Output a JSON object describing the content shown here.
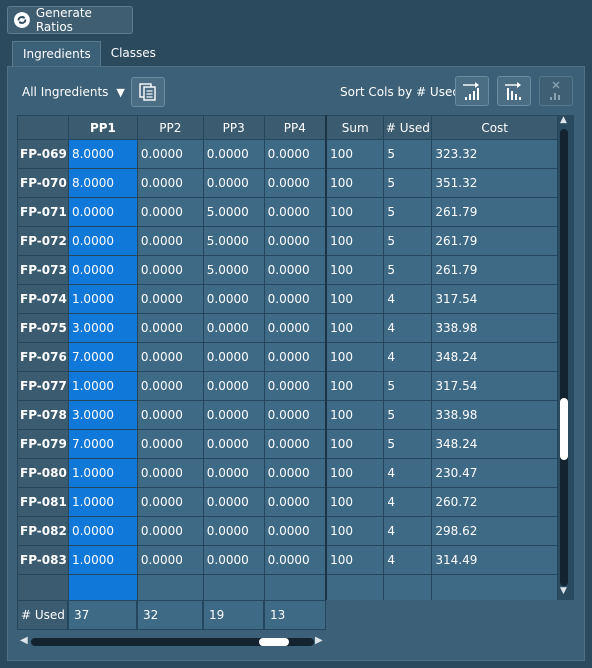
{
  "toolbar": {
    "generate_label": "Generate Ratios",
    "generate_icon": "refresh-icon"
  },
  "tabs": [
    {
      "label": "Ingredients",
      "active": true
    },
    {
      "label": "Classes",
      "active": false
    }
  ],
  "filter": {
    "selected": "All Ingredients",
    "copy_icon": "copy-icon"
  },
  "sort": {
    "label": "Sort Cols by # Used:",
    "buttons": [
      {
        "icon": "sort-ascending-icon",
        "enabled": true
      },
      {
        "icon": "sort-descending-icon",
        "enabled": true
      },
      {
        "icon": "clear-sort-icon",
        "enabled": false
      }
    ]
  },
  "grid": {
    "columns": [
      "PP1",
      "PP2",
      "PP3",
      "PP4",
      "Sum",
      "# Used",
      "Cost"
    ],
    "selected_column": "PP1",
    "rows": [
      {
        "id": "FP-069",
        "values": [
          "8.0000",
          "0.0000",
          "0.0000",
          "0.0000",
          "100",
          "5",
          "323.32"
        ]
      },
      {
        "id": "FP-070",
        "values": [
          "8.0000",
          "0.0000",
          "0.0000",
          "0.0000",
          "100",
          "5",
          "351.32"
        ]
      },
      {
        "id": "FP-071",
        "values": [
          "0.0000",
          "0.0000",
          "5.0000",
          "0.0000",
          "100",
          "5",
          "261.79"
        ]
      },
      {
        "id": "FP-072",
        "values": [
          "0.0000",
          "0.0000",
          "5.0000",
          "0.0000",
          "100",
          "5",
          "261.79"
        ]
      },
      {
        "id": "FP-073",
        "values": [
          "0.0000",
          "0.0000",
          "5.0000",
          "0.0000",
          "100",
          "5",
          "261.79"
        ]
      },
      {
        "id": "FP-074",
        "values": [
          "1.0000",
          "0.0000",
          "0.0000",
          "0.0000",
          "100",
          "4",
          "317.54"
        ]
      },
      {
        "id": "FP-075",
        "values": [
          "3.0000",
          "0.0000",
          "0.0000",
          "0.0000",
          "100",
          "4",
          "338.98"
        ]
      },
      {
        "id": "FP-076",
        "values": [
          "7.0000",
          "0.0000",
          "0.0000",
          "0.0000",
          "100",
          "4",
          "348.24"
        ]
      },
      {
        "id": "FP-077",
        "values": [
          "1.0000",
          "0.0000",
          "0.0000",
          "0.0000",
          "100",
          "5",
          "317.54"
        ]
      },
      {
        "id": "FP-078",
        "values": [
          "3.0000",
          "0.0000",
          "0.0000",
          "0.0000",
          "100",
          "5",
          "338.98"
        ]
      },
      {
        "id": "FP-079",
        "values": [
          "7.0000",
          "0.0000",
          "0.0000",
          "0.0000",
          "100",
          "5",
          "348.24"
        ]
      },
      {
        "id": "FP-080",
        "values": [
          "1.0000",
          "0.0000",
          "0.0000",
          "0.0000",
          "100",
          "4",
          "230.47"
        ]
      },
      {
        "id": "FP-081",
        "values": [
          "1.0000",
          "0.0000",
          "0.0000",
          "0.0000",
          "100",
          "4",
          "260.72"
        ]
      },
      {
        "id": "FP-082",
        "values": [
          "0.0000",
          "0.0000",
          "0.0000",
          "0.0000",
          "100",
          "4",
          "298.62"
        ]
      },
      {
        "id": "FP-083",
        "values": [
          "1.0000",
          "0.0000",
          "0.0000",
          "0.0000",
          "100",
          "4",
          "314.49"
        ]
      }
    ],
    "footer": {
      "label": "# Used",
      "values": [
        "37",
        "32",
        "19",
        "13"
      ]
    }
  },
  "scroll": {
    "vertical_position": 0.68,
    "horizontal_position": 0.9
  }
}
